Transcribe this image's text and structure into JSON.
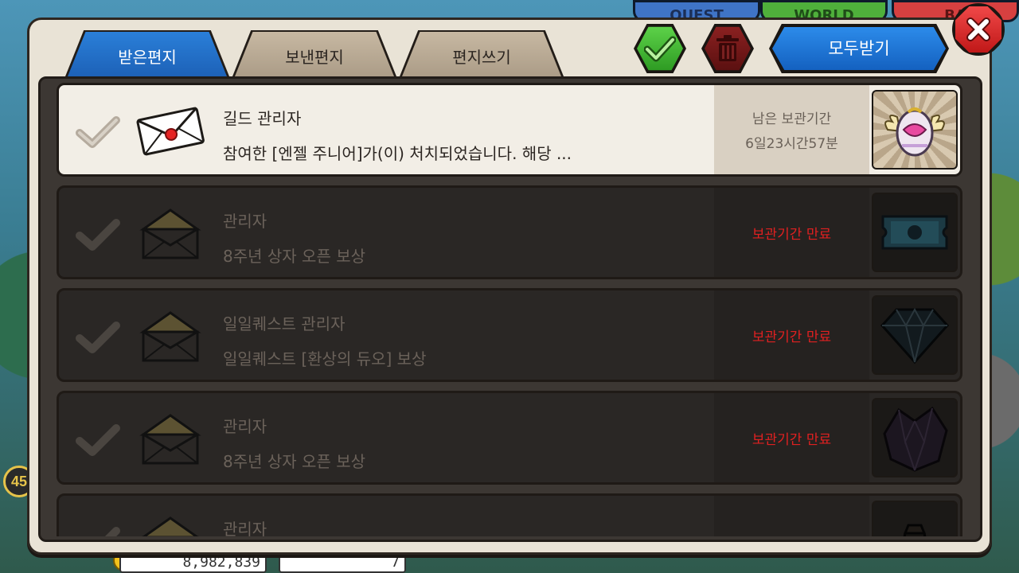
{
  "background": {
    "tabs": [
      "QUEST",
      "WORLD",
      "BA"
    ],
    "level": "45",
    "gold": "8,982,839",
    "gems": "7"
  },
  "tabs": [
    {
      "label": "받은편지",
      "active": true
    },
    {
      "label": "보낸편지",
      "active": false
    },
    {
      "label": "편지쓰기",
      "active": false
    }
  ],
  "toolbar": {
    "select_all_icon": "check-icon",
    "delete_icon": "trash-icon",
    "receive_all_label": "모두받기",
    "close_icon": "close-icon"
  },
  "mails": [
    {
      "sender": "길드 관리자",
      "message": "참여한 [엔젤 주니어]가(이) 처치되었습니다. 해당 ...",
      "status_line1": "남은 보관기간",
      "status_line2": "6일23시간57분",
      "expired": false,
      "item_icon": "angel-egg-icon"
    },
    {
      "sender": "관리자",
      "message": "8주년 상자 오픈 보상",
      "status_line1": "보관기간 만료",
      "expired": true,
      "item_icon": "ticket-icon"
    },
    {
      "sender": "일일퀘스트 관리자",
      "message": "일일퀘스트 [환상의 듀오] 보상",
      "status_line1": "보관기간 만료",
      "expired": true,
      "item_icon": "diamond-icon"
    },
    {
      "sender": "관리자",
      "message": "8주년 상자 오픈 보상",
      "status_line1": "보관기간 만료",
      "expired": true,
      "item_icon": "crystal-icon"
    },
    {
      "sender": "관리자",
      "message": "",
      "status_line1": "",
      "expired": true,
      "item_icon": "pouch-icon"
    }
  ],
  "colors": {
    "active_tab": "#1c5fb5",
    "expired_text": "#e02020",
    "confirm_green": "#2d9a22",
    "delete_red": "#5a1010"
  }
}
